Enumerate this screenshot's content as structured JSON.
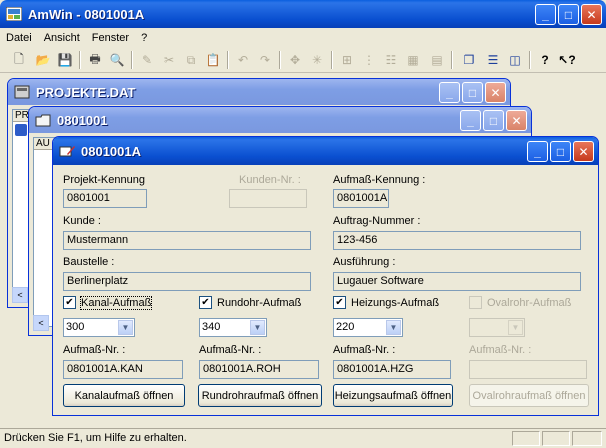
{
  "app": {
    "title": "AmWin - 0801001A"
  },
  "menu": [
    "Datei",
    "Ansicht",
    "Fenster",
    "?"
  ],
  "toolbar_icons": [
    "new-icon",
    "open-icon",
    "save-icon",
    "print-icon",
    "print-preview-icon",
    "edit-icon",
    "cut-icon",
    "copy-icon",
    "paste-icon",
    "undo-icon",
    "redo-icon",
    "move-icon",
    "split-icon",
    "tool1-icon",
    "tool2-icon",
    "tool3-icon",
    "tool4-icon",
    "tool5-icon",
    "cascade-icon",
    "tile-horizontal-icon",
    "tile-vertical-icon",
    "help-icon",
    "context-help-icon"
  ],
  "windows": {
    "projects": {
      "title": "PROJEKTE.DAT",
      "col_hint": "PR"
    },
    "project": {
      "title": "0801001",
      "col_hint": "AU"
    },
    "detail": {
      "title": "0801001A"
    }
  },
  "form": {
    "projekt_kennung": {
      "label": "Projekt-Kennung",
      "value": "0801001"
    },
    "kunden_nr": {
      "label": "Kunden-Nr. :",
      "value": ""
    },
    "aufmass_kennung": {
      "label": "Aufmaß-Kennung :",
      "value": "0801001A"
    },
    "kunde": {
      "label": "Kunde :",
      "value": "Mustermann"
    },
    "auftrag_nummer": {
      "label": "Auftrag-Nummer :",
      "value": "123-456"
    },
    "baustelle": {
      "label": "Baustelle :",
      "value": "Berlinerplatz"
    },
    "ausfuehrung": {
      "label": "Ausführung :",
      "value": "Lugauer Software"
    },
    "sections": [
      {
        "check_label": "Kanal-Aufmaß",
        "checked": true,
        "enabled": true,
        "combo": "300",
        "nr_label": "Aufmaß-Nr. :",
        "nr_value": "0801001A.KAN",
        "button": "Kanalaufmaß öffnen"
      },
      {
        "check_label": "Rundohr-Aufmaß",
        "checked": true,
        "enabled": true,
        "combo": "340",
        "nr_label": "Aufmaß-Nr. :",
        "nr_value": "0801001A.ROH",
        "button": "Rundrohraufmaß öffnen"
      },
      {
        "check_label": "Heizungs-Aufmaß",
        "checked": true,
        "enabled": true,
        "combo": "220",
        "nr_label": "Aufmaß-Nr. :",
        "nr_value": "0801001A.HZG",
        "button": "Heizungsaufmaß öffnen"
      },
      {
        "check_label": "Ovalrohr-Aufmaß",
        "checked": false,
        "enabled": false,
        "combo": "",
        "nr_label": "Aufmaß-Nr. :",
        "nr_value": "",
        "button": "Ovalrohraufmaß öffnen"
      }
    ]
  },
  "status": {
    "text": "Drücken Sie F1, um Hilfe zu erhalten."
  }
}
